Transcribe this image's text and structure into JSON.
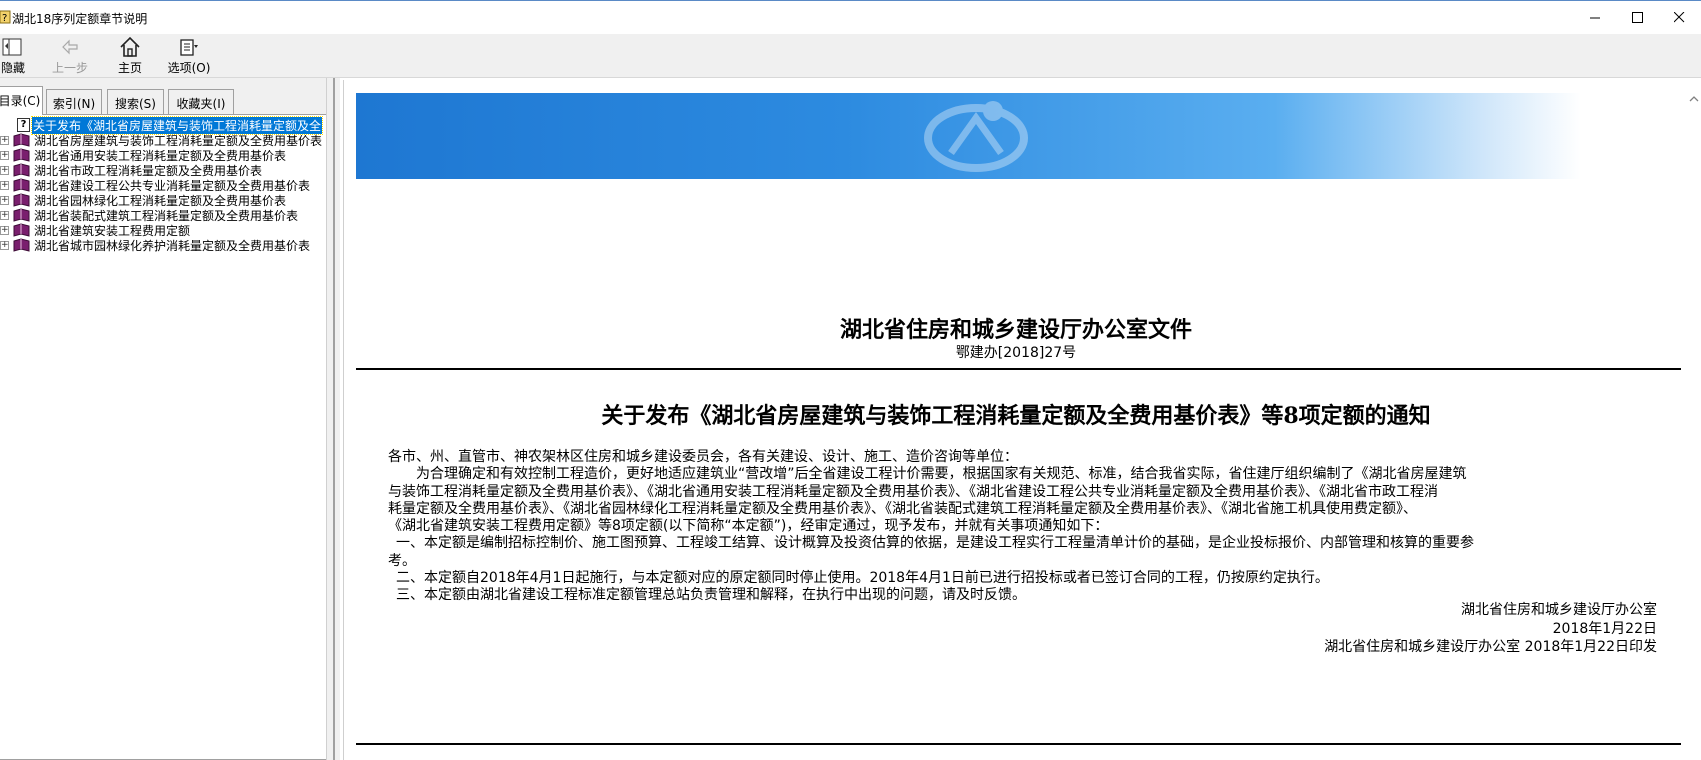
{
  "window": {
    "title": "湖北18序列定额章节说明",
    "controls": [
      "minimize",
      "maximize",
      "close"
    ]
  },
  "toolbar": {
    "hide_label": "隐藏",
    "back_label": "上一步",
    "home_label": "主页",
    "options_label": "选项(O)"
  },
  "tabs": [
    "目录(C)",
    "索引(N)",
    "搜索(S)",
    "收藏夹(I)"
  ],
  "tree": {
    "selected": "关于发布《湖北省房屋建筑与装饰工程消耗量定额及全",
    "items": [
      "湖北省房屋建筑与装饰工程消耗量定额及全费用基价表",
      "湖北省通用安装工程消耗量定额及全费用基价表",
      "湖北省市政工程消耗量定额及全费用基价表",
      "湖北省建设工程公共专业消耗量定额及全费用基价表",
      "湖北省园林绿化工程消耗量定额及全费用基价表",
      "湖北省装配式建筑工程消耗量定额及全费用基价表",
      "湖北省建筑安装工程费用定额",
      "湖北省城市园林绿化养护消耗量定额及全费用基价表"
    ]
  },
  "document": {
    "header_title": "湖北省住房和城乡建设厅办公室文件",
    "number": "鄂建办[2018]27号",
    "notice_title": "关于发布《湖北省房屋建筑与装饰工程消耗量定额及全费用基价表》等8项定额的通知",
    "salutation": "各市、州、直管市、神农架林区住房和城乡建设委员会，各有关建设、设计、施工、造价咨询等单位：",
    "para1_line1": "为合理确定和有效控制工程造价，更好地适应建筑业“营改增”后全省建设工程计价需要，根据国家有关规范、标准，结合我省实际，省住建厅组织编制了《湖北省房屋建筑",
    "para1_line2": "与装饰工程消耗量定额及全费用基价表》、《湖北省通用安装工程消耗量定额及全费用基价表》、《湖北省建设工程公共专业消耗量定额及全费用基价表》、《湖北省市政工程消",
    "para1_line3": "耗量定额及全费用基价表》、《湖北省园林绿化工程消耗量定额及全费用基价表》、《湖北省装配式建筑工程消耗量定额及全费用基价表》、《湖北省施工机具使用费定额》、",
    "para1_line4": "《湖北省建筑安装工程费用定额》等8项定额(以下简称“本定额”)，经审定通过，现予发布，并就有关事项通知如下：",
    "item1_line1": "一、本定额是编制招标控制价、施工图预算、工程竣工结算、设计概算及投资估算的依据，是建设工程实行工程量清单计价的基础，是企业投标报价、内部管理和核算的重要参",
    "item1_line2": "考。",
    "item2": "二、本定额自2018年4月1日起施行，与本定额对应的原定额同时停止使用。2018年4月1日前已进行招投标或者已签订合同的工程，仍按原约定执行。",
    "item3": "三、本定额由湖北省建设工程标准定额管理总站负责管理和解释，在执行中出现的问题，请及时反馈。",
    "signature_org": "湖北省住房和城乡建设厅办公室",
    "signature_date": "2018年1月22日",
    "print_line": "湖北省住房和城乡建设厅办公室  2018年1月22日印发"
  },
  "colors": {
    "selection": "#0078d7",
    "banner_start": "#1e77d2",
    "book_icon": "#7a1f6e"
  }
}
